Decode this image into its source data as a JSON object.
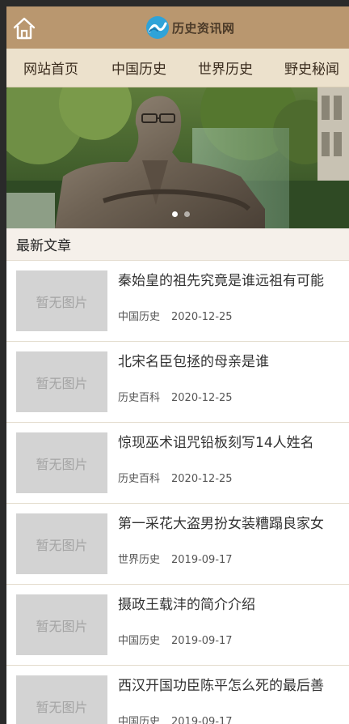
{
  "header": {
    "home_icon": "home-icon",
    "logo_text": "历史资讯网"
  },
  "nav": [
    {
      "label": "网站首页"
    },
    {
      "label": "中国历史"
    },
    {
      "label": "世界历史"
    },
    {
      "label": "野史秘闻"
    }
  ],
  "banner": {
    "active_slide": 1,
    "slide_count": 2
  },
  "section": {
    "title": "最新文章"
  },
  "articles": [
    {
      "thumb_text": "暂无图片",
      "title": "秦始皇的祖先究竟是谁远祖有可能",
      "category": "中国历史",
      "date": "2020-12-25"
    },
    {
      "thumb_text": "暂无图片",
      "title": "北宋名臣包拯的母亲是谁",
      "category": "历史百科",
      "date": "2020-12-25"
    },
    {
      "thumb_text": "暂无图片",
      "title": "惊现巫术诅咒铅板刻写14人姓名",
      "category": "历史百科",
      "date": "2020-12-25"
    },
    {
      "thumb_text": "暂无图片",
      "title": "第一采花大盗男扮女装糟蹋良家女",
      "category": "世界历史",
      "date": "2019-09-17"
    },
    {
      "thumb_text": "暂无图片",
      "title": "摄政王载沣的简介介绍",
      "category": "中国历史",
      "date": "2019-09-17"
    },
    {
      "thumb_text": "暂无图片",
      "title": "西汉开国功臣陈平怎么死的最后善",
      "category": "中国历史",
      "date": "2019-09-17"
    }
  ],
  "colors": {
    "header_bg": "#b9976f",
    "nav_bg": "#ece1cc",
    "placeholder_bg": "#d3d3d3"
  }
}
